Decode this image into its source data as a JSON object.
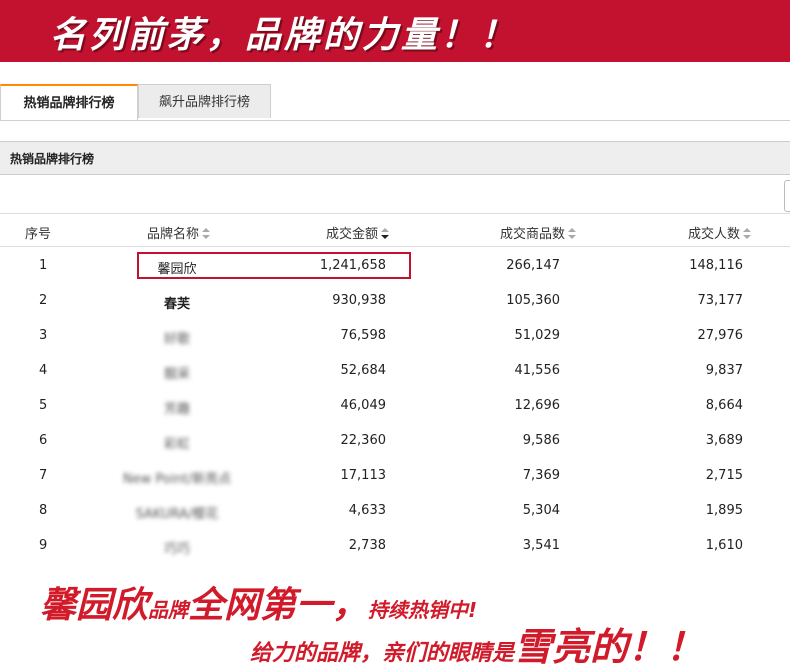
{
  "banner": {
    "text": "名列前茅，品牌的力量！！"
  },
  "tabs": [
    {
      "label": "热销品牌排行榜",
      "active": true
    },
    {
      "label": "飙升品牌排行榜",
      "active": false
    }
  ],
  "section": {
    "title": "热销品牌排行榜"
  },
  "table": {
    "headers": {
      "rank": "序号",
      "brand": "品牌名称",
      "amount": "成交金额",
      "items": "成交商品数",
      "people": "成交人数"
    },
    "sorted_by": "amount",
    "rows": [
      {
        "rank": "1",
        "brand": "馨园欣",
        "amount": "1,241,658",
        "items": "266,147",
        "people": "148,116"
      },
      {
        "rank": "2",
        "brand": "春芙",
        "amount": "930,938",
        "items": "105,360",
        "people": "73,177"
      },
      {
        "rank": "3",
        "brand": "好歌",
        "amount": "76,598",
        "items": "51,029",
        "people": "27,976"
      },
      {
        "rank": "4",
        "brand": "靓采",
        "amount": "52,684",
        "items": "41,556",
        "people": "9,837"
      },
      {
        "rank": "5",
        "brand": "芳趣",
        "amount": "46,049",
        "items": "12,696",
        "people": "8,664"
      },
      {
        "rank": "6",
        "brand": "彩虹",
        "amount": "22,360",
        "items": "9,586",
        "people": "3,689"
      },
      {
        "rank": "7",
        "brand": "New Point/新亮点",
        "amount": "17,113",
        "items": "7,369",
        "people": "2,715"
      },
      {
        "rank": "8",
        "brand": "SAKURA/樱花",
        "amount": "4,633",
        "items": "5,304",
        "people": "1,895"
      },
      {
        "rank": "9",
        "brand": "巧巧",
        "amount": "2,738",
        "items": "3,541",
        "people": "1,610"
      }
    ]
  },
  "promo": {
    "line1_brand": "馨园欣",
    "line1_small": "品牌",
    "line1_big": "全网第一，",
    "line1_tail": "持续热销中!",
    "line2_small": "给力的品牌，亲们的眼睛是",
    "line2_big": "雪亮的！！"
  },
  "colors": {
    "banner": "#c3122f",
    "tab_accent": "#ff8a00",
    "promo": "#d11a2a"
  }
}
